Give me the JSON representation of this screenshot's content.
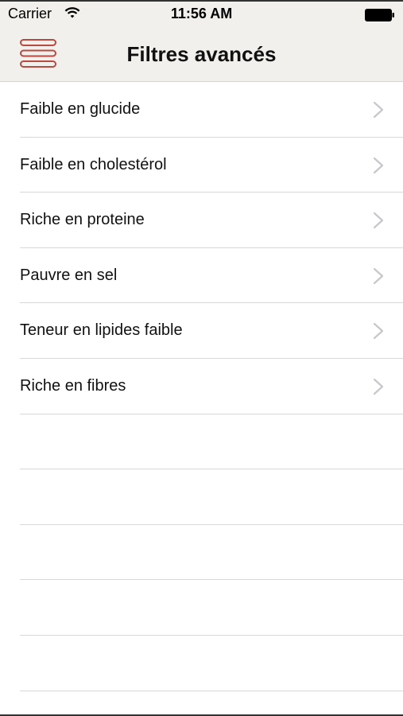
{
  "status_bar": {
    "carrier": "Carrier",
    "time": "11:56 AM",
    "wifi_icon": "wifi-icon",
    "battery_icon": "battery-icon"
  },
  "nav_bar": {
    "title": "Filtres avancés",
    "menu_icon": "hamburger-menu-icon",
    "menu_color": "#b84a40"
  },
  "filters": {
    "items": [
      {
        "label": "Faible en glucide"
      },
      {
        "label": "Faible en cholestérol"
      },
      {
        "label": "Riche en proteine"
      },
      {
        "label": "Pauvre en sel"
      },
      {
        "label": "Teneur en lipides faible"
      },
      {
        "label": "Riche en fibres"
      }
    ],
    "chevron_icon": "chevron-right-icon"
  }
}
